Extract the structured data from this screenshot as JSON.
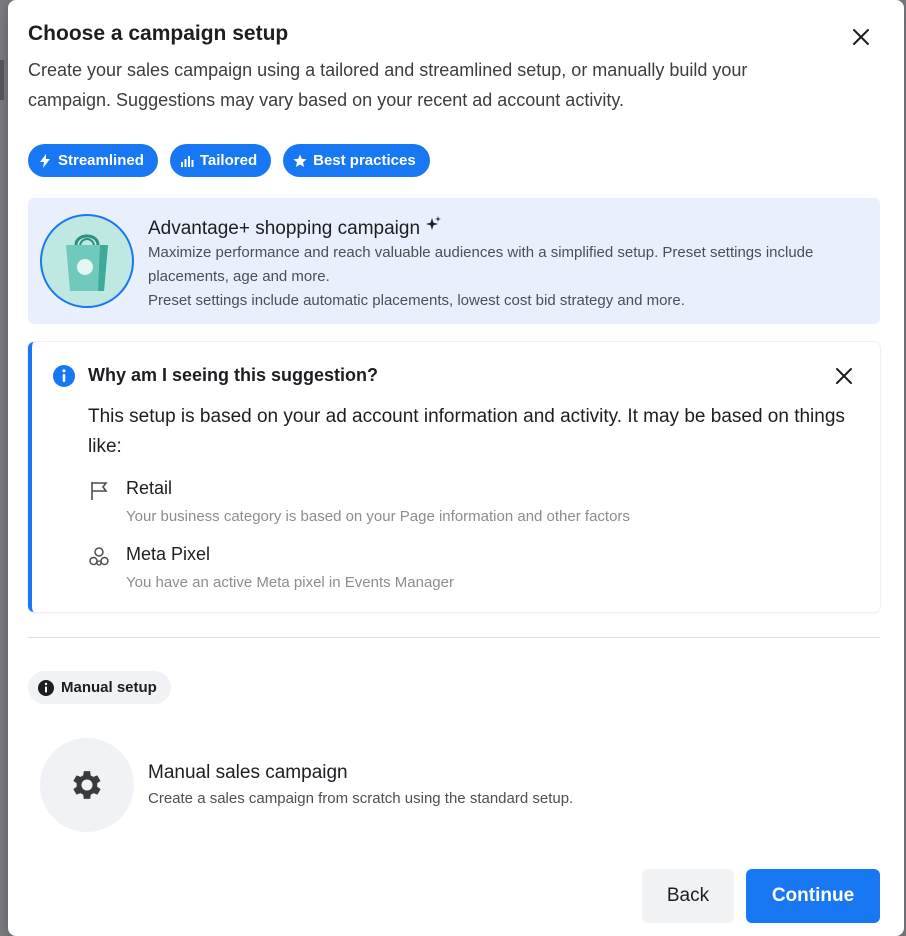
{
  "dialog": {
    "title": "Choose a campaign setup",
    "subtitle": "Create your sales campaign using a tailored and streamlined setup, or manually build your campaign. Suggestions may vary based on your recent ad account activity.",
    "close_icon": "close-icon"
  },
  "tags": [
    {
      "label": "Streamlined",
      "icon": "lightning-icon"
    },
    {
      "label": "Tailored",
      "icon": "bar-chart-icon"
    },
    {
      "label": "Best practices",
      "icon": "star-icon"
    }
  ],
  "advantage_card": {
    "title": "Advantage+ shopping campaign",
    "title_icon": "sparkle-icon",
    "description_line1": "Maximize performance and reach valuable audiences with a simplified setup. Preset settings include placements, age and more.",
    "description_line2": "Preset settings include automatic placements, lowest cost bid strategy and more.",
    "icon": "shopping-bag-icon"
  },
  "why_card": {
    "title": "Why am I seeing this suggestion?",
    "body": "This setup is based on your ad account information and activity. It may be based on things like:",
    "reasons": [
      {
        "title": "Retail",
        "subtitle": "Your business category is based on your Page information and other factors",
        "icon": "flag-icon"
      },
      {
        "title": "Meta Pixel",
        "subtitle": "You have an active Meta pixel in Events Manager",
        "icon": "pixel-icon"
      }
    ]
  },
  "manual": {
    "chip_label": "Manual setup",
    "title": "Manual sales campaign",
    "description": "Create a sales campaign from scratch using the standard setup.",
    "icon": "gear-icon"
  },
  "footer": {
    "back_label": "Back",
    "continue_label": "Continue"
  },
  "colors": {
    "accent": "#1877f2",
    "card_highlight": "#e9effc",
    "muted_bg": "#f0f2f5"
  }
}
